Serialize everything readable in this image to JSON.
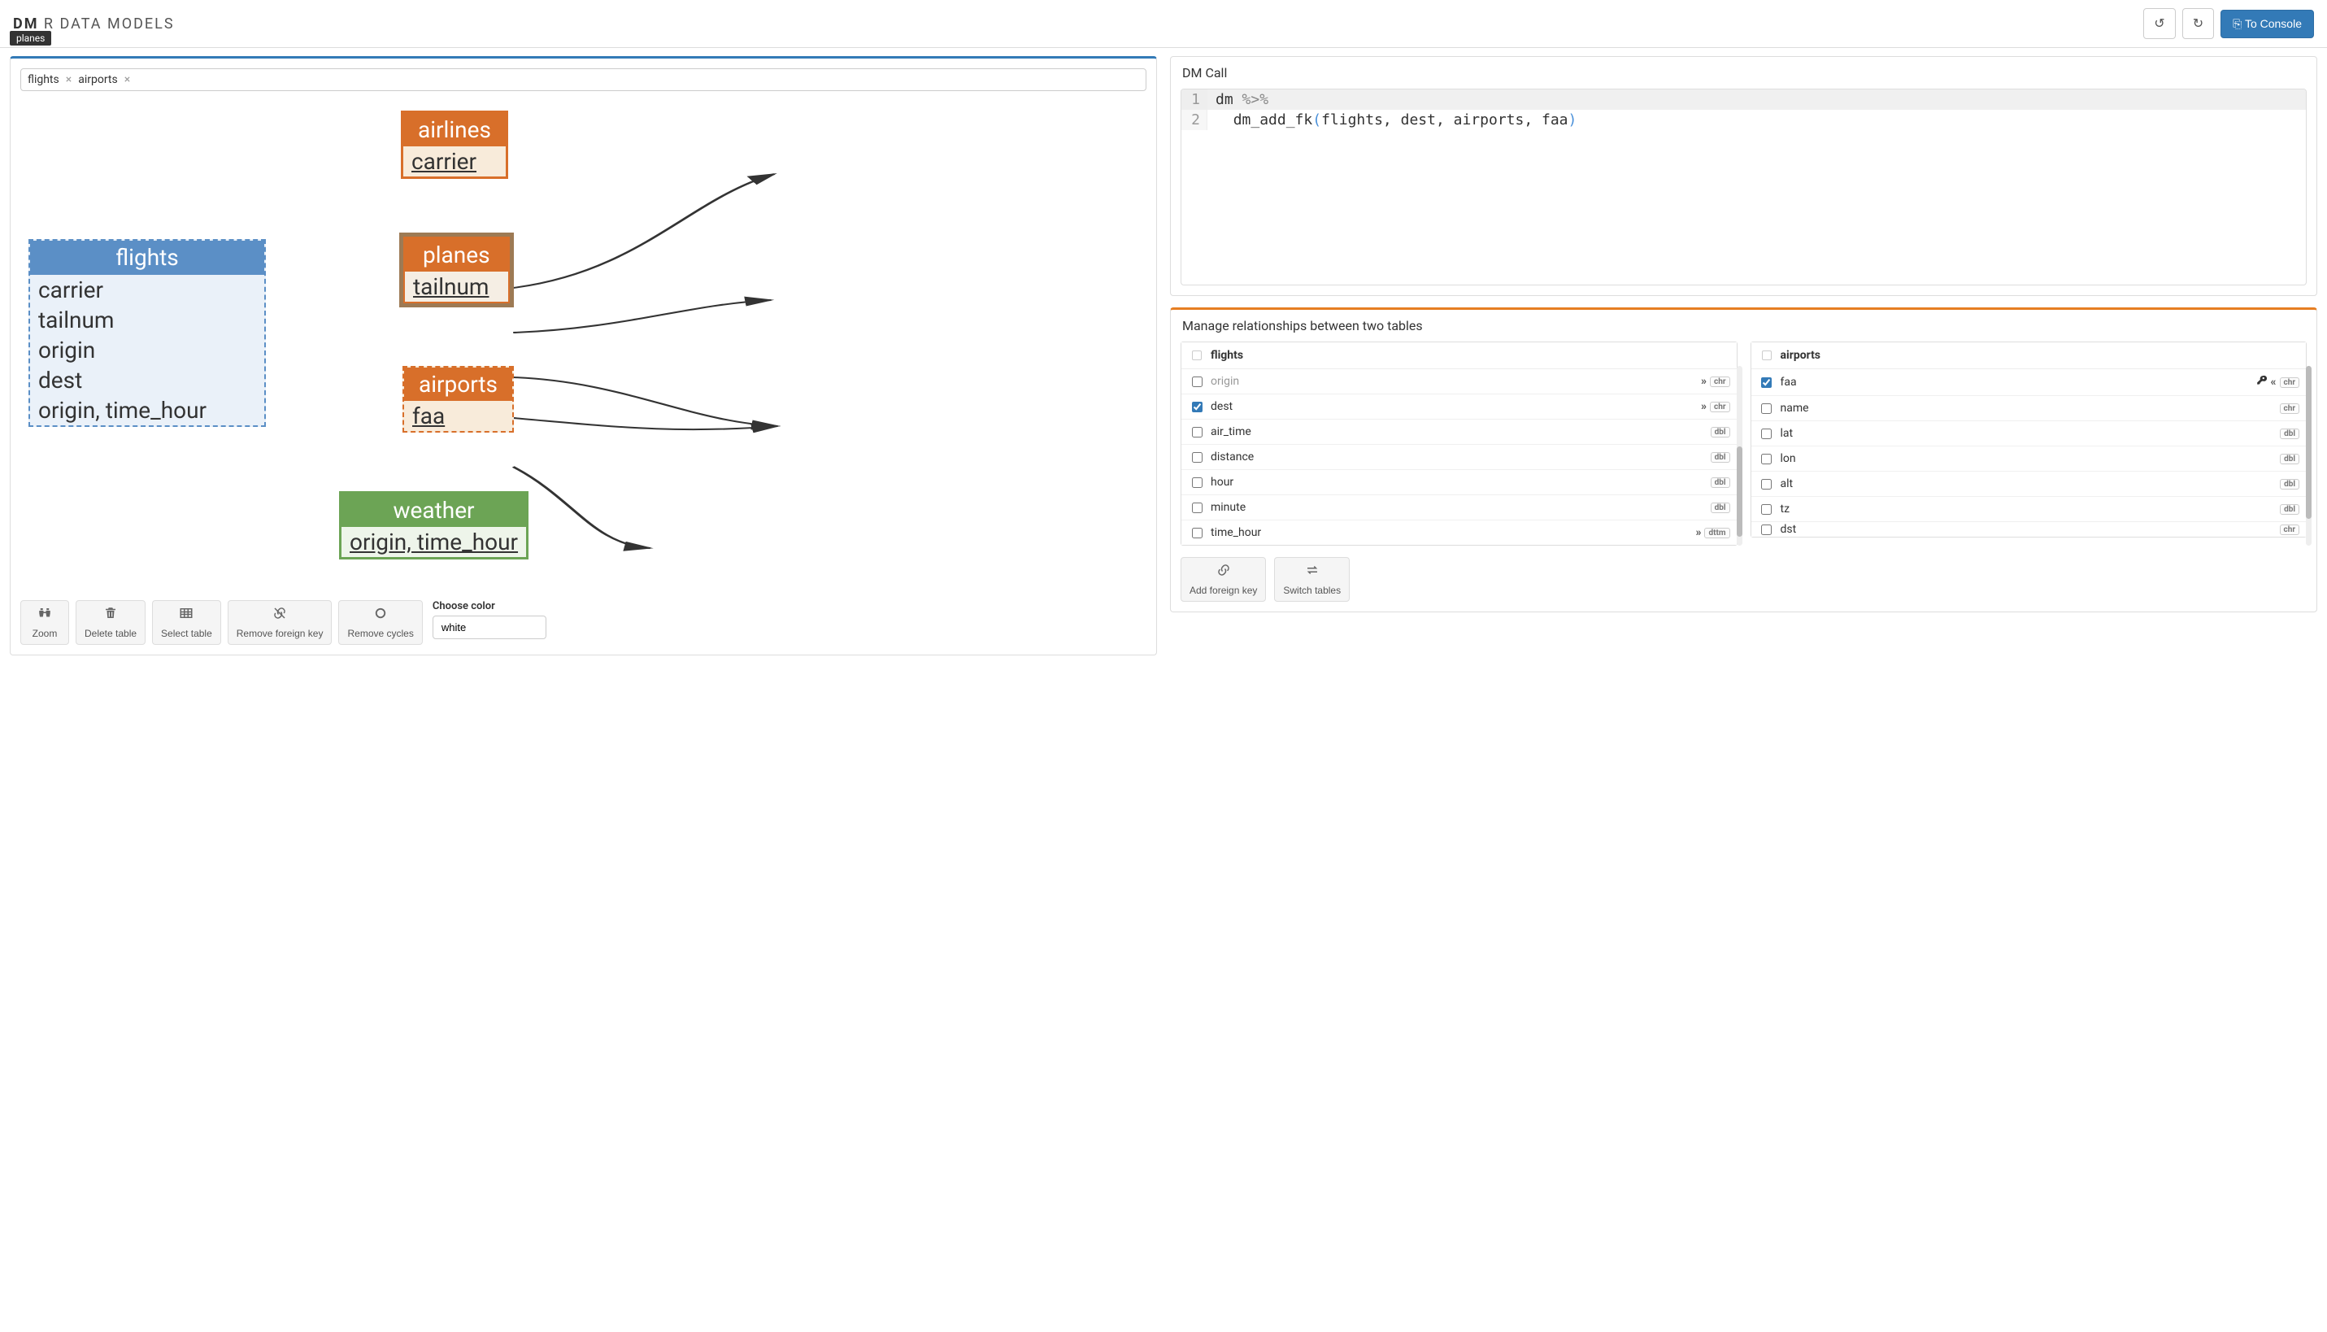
{
  "header": {
    "logo_bold": "DM",
    "logo_light": " R DATA MODELS",
    "undo_title": "Undo",
    "redo_title": "Redo",
    "to_console": "To Console"
  },
  "tooltip": "planes",
  "search": {
    "chips": [
      "flights",
      "airports"
    ]
  },
  "diagram": {
    "flights": {
      "title": "flights",
      "rows": [
        "carrier",
        "tailnum",
        "origin",
        "dest",
        "origin, time_hour"
      ]
    },
    "airlines": {
      "title": "airlines",
      "key": "carrier"
    },
    "planes": {
      "title": "planes",
      "key": "tailnum"
    },
    "airports": {
      "title": "airports",
      "key": "faa"
    },
    "weather": {
      "title": "weather",
      "key": "origin, time_hour"
    }
  },
  "toolbar": {
    "zoom": "Zoom",
    "delete_table": "Delete table",
    "select_table": "Select table",
    "remove_fk": "Remove foreign key",
    "remove_cycles": "Remove cycles",
    "choose_color": "Choose color",
    "color_value": "white"
  },
  "dm_call": {
    "title": "DM Call",
    "line1_a": "dm ",
    "line1_op": "%>%",
    "line2_indent": "  ",
    "line2_fn": "dm_add_fk",
    "line2_args": "flights, dest, airports, faa"
  },
  "rel": {
    "title": "Manage relationships between two tables",
    "left": {
      "name": "flights",
      "rows": [
        {
          "name": "origin",
          "checked": false,
          "arrow": true,
          "type": "chr",
          "faded": true
        },
        {
          "name": "dest",
          "checked": true,
          "arrow": true,
          "type": "chr"
        },
        {
          "name": "air_time",
          "checked": false,
          "arrow": false,
          "type": "dbl"
        },
        {
          "name": "distance",
          "checked": false,
          "arrow": false,
          "type": "dbl"
        },
        {
          "name": "hour",
          "checked": false,
          "arrow": false,
          "type": "dbl"
        },
        {
          "name": "minute",
          "checked": false,
          "arrow": false,
          "type": "dbl"
        },
        {
          "name": "time_hour",
          "checked": false,
          "arrow": true,
          "type": "dttm"
        }
      ]
    },
    "right": {
      "name": "airports",
      "rows": [
        {
          "name": "faa",
          "checked": true,
          "pk": true,
          "type": "chr"
        },
        {
          "name": "name",
          "checked": false,
          "type": "chr"
        },
        {
          "name": "lat",
          "checked": false,
          "type": "dbl"
        },
        {
          "name": "lon",
          "checked": false,
          "type": "dbl"
        },
        {
          "name": "alt",
          "checked": false,
          "type": "dbl"
        },
        {
          "name": "tz",
          "checked": false,
          "type": "dbl"
        },
        {
          "name": "dst",
          "checked": false,
          "type": "chr",
          "cut": true
        }
      ]
    },
    "add_fk": "Add foreign key",
    "switch": "Switch tables"
  }
}
